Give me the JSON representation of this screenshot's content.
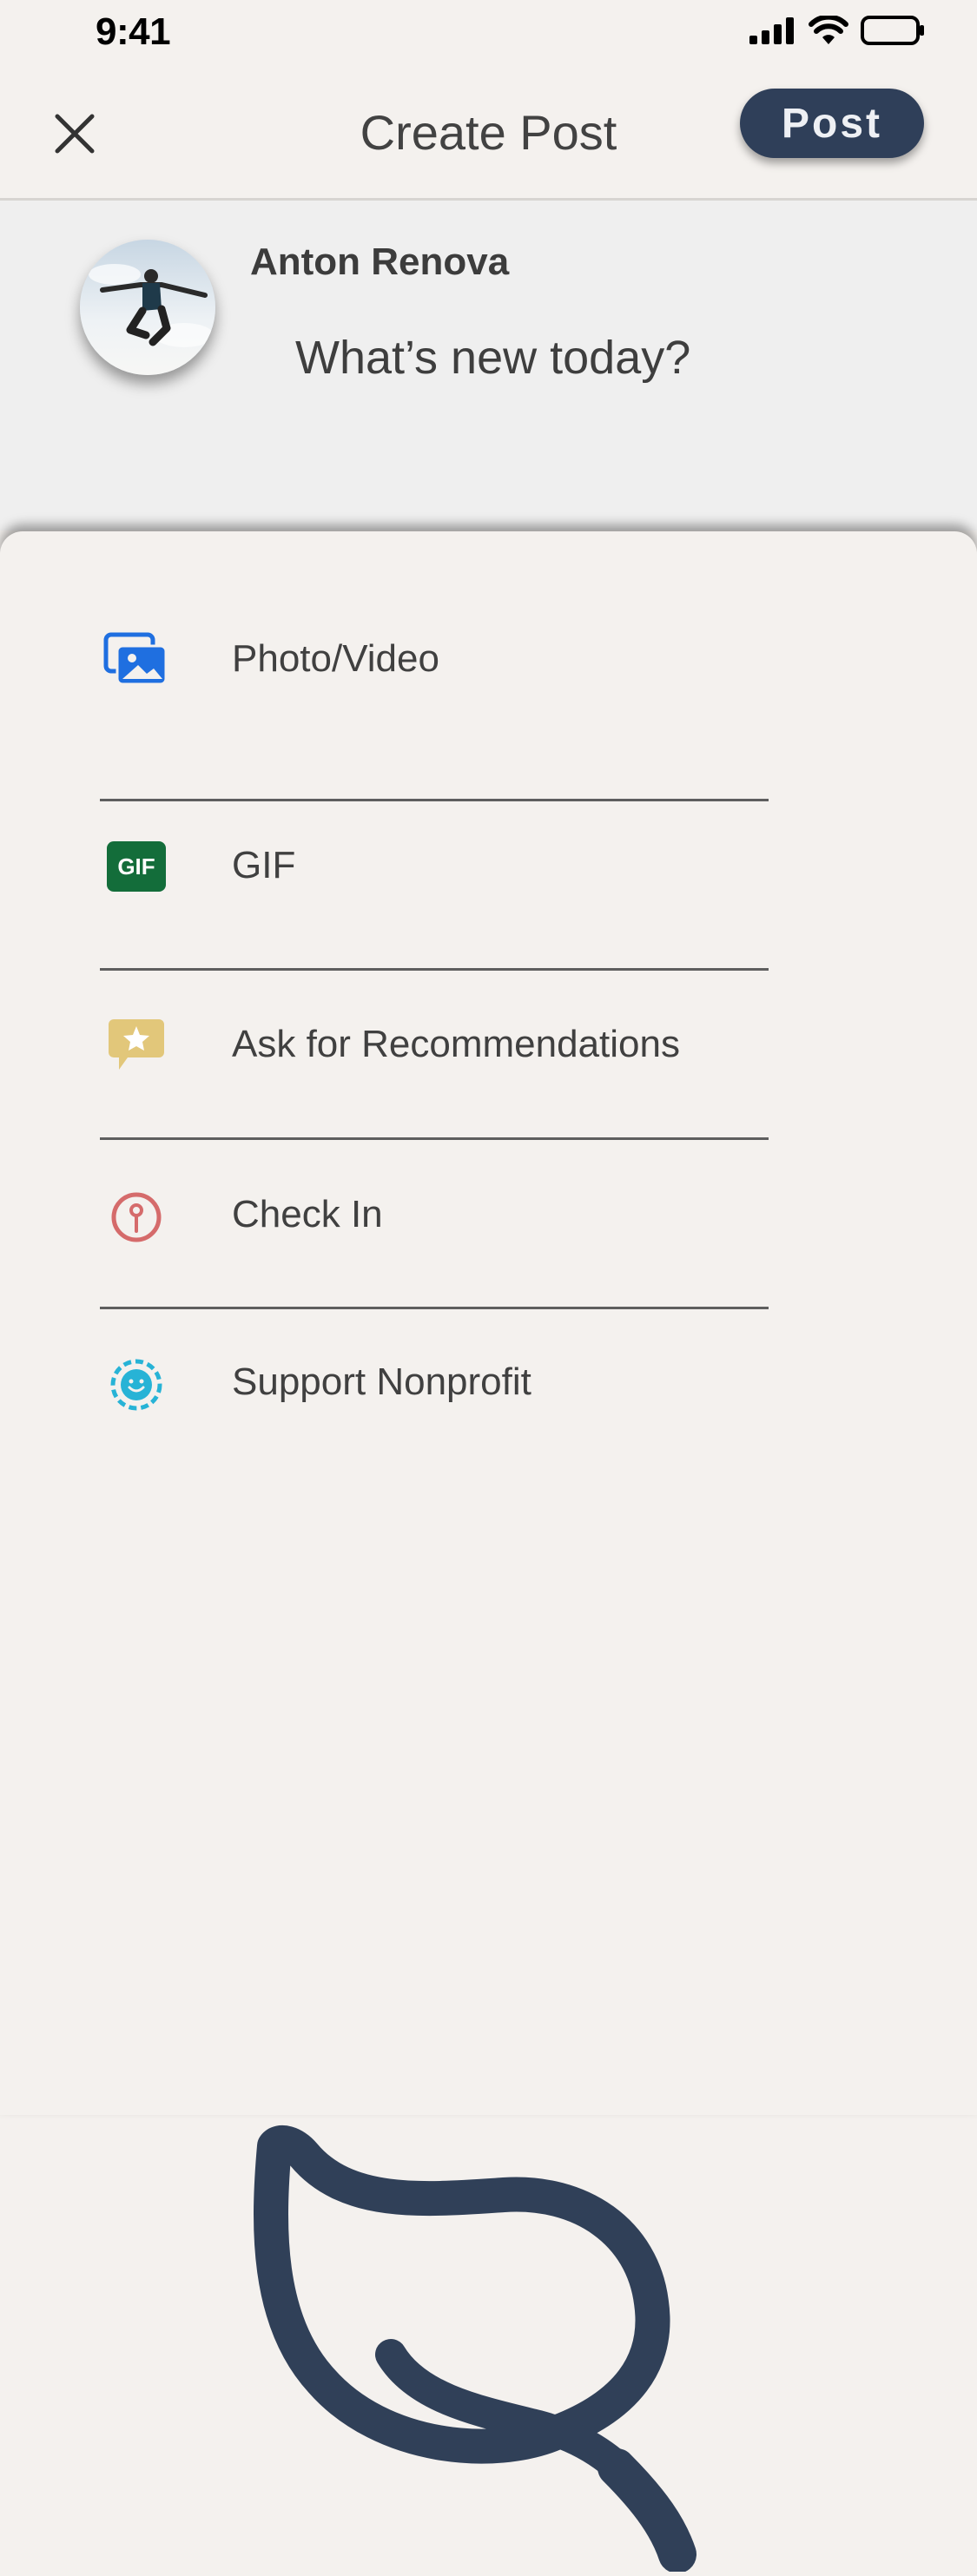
{
  "status_bar": {
    "time": "9:41"
  },
  "header": {
    "title": "Create Post",
    "post_label": "Post"
  },
  "composer": {
    "username": "Anton Renova",
    "placeholder": "What’s new today?"
  },
  "options": [
    {
      "label": "Photo/Video",
      "icon": "photo-video-icon",
      "color": "#1f6fe0"
    },
    {
      "label": "GIF",
      "icon": "gif-icon",
      "icon_text": "GIF",
      "color": "#136d3a"
    },
    {
      "label": "Ask for Recommendations",
      "icon": "recommendation-icon",
      "color": "#e2c77a"
    },
    {
      "label": "Check In",
      "icon": "location-pin-icon",
      "color": "#d56b6b"
    },
    {
      "label": "Support Nonprofit",
      "icon": "nonprofit-smile-icon",
      "color": "#27b3d6"
    }
  ],
  "colors": {
    "accent": "#2f3f59",
    "background": "#f4f1ee",
    "composer_background": "#efefef"
  }
}
